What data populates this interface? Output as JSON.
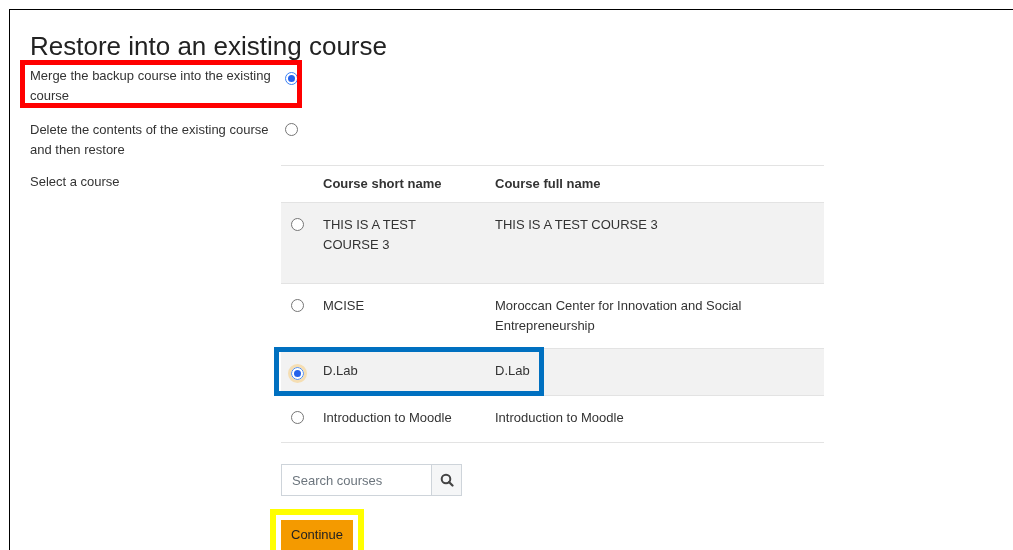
{
  "title": "Restore into an existing course",
  "options": [
    {
      "label": "Merge the backup course into the existing course",
      "selected": true,
      "highlighted": true
    },
    {
      "label": "Delete the contents of the existing course and then restore",
      "selected": false,
      "highlighted": false
    }
  ],
  "select_label": "Select a course",
  "table": {
    "columns": [
      "Course short name",
      "Course full name"
    ],
    "rows": [
      {
        "short_name": "THIS IS A TEST COURSE 3",
        "full_name": "THIS IS A TEST COURSE 3",
        "selected": false,
        "highlighted": false
      },
      {
        "short_name": "MCISE",
        "full_name": "Moroccan Center for Innovation and Social Entrepreneurship",
        "selected": false,
        "highlighted": false
      },
      {
        "short_name": "D.Lab",
        "full_name": "D.Lab",
        "selected": true,
        "highlighted": true
      },
      {
        "short_name": "Introduction to Moodle",
        "full_name": "Introduction to Moodle",
        "selected": false,
        "highlighted": false
      }
    ]
  },
  "search": {
    "placeholder": "Search courses"
  },
  "continue_button": {
    "label": "Continue",
    "highlighted": true
  }
}
